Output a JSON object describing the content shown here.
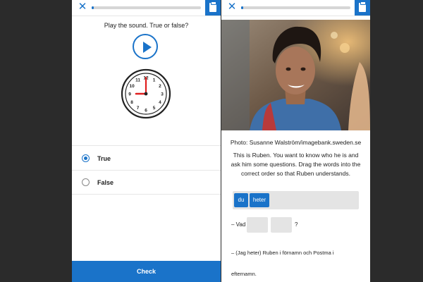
{
  "left": {
    "progress": 0.02,
    "prompt": "Play the sound. True or false?",
    "clock_numbers": [
      "12",
      "1",
      "2",
      "3",
      "4",
      "5",
      "6",
      "7",
      "8",
      "9",
      "10",
      "11"
    ],
    "options": [
      {
        "label": "True",
        "selected": true
      },
      {
        "label": "False",
        "selected": false
      }
    ],
    "check_label": "Check"
  },
  "right": {
    "progress": 0.02,
    "credit": "Photo: Susanne Walström/imagebank.sweden.se",
    "instruction": "This is Ruben. You want to know who he is and ask him some questions. Drag the words into the correct order so that Ruben understands.",
    "chips": [
      "du",
      "heter"
    ],
    "question_prefix": "– Vad",
    "question_suffix": "?",
    "answer_line1": "– (Jag heter) Ruben i förnamn och Postma i",
    "answer_line2": "efternamn."
  },
  "icons": {
    "close": "close-icon",
    "notes": "notes-icon",
    "play": "play-icon",
    "clock": "clock-illustration"
  },
  "colors": {
    "accent": "#1a73c9",
    "background": "#2b2b2b"
  }
}
